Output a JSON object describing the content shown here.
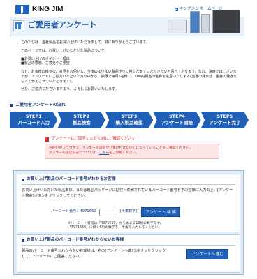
{
  "header": {
    "brand": "KING JIM",
    "home_link": "キングジム ホームページ"
  },
  "banner": {
    "title": "ご愛用者アンケート"
  },
  "intro": {
    "p1": "このたびは、当社製品をお買い上げいただきまして、誠にありがとうございます。",
    "p2": "このページでは、お買い上げいただいた製品について、",
    "p3a": "■お買い上げのポイント・理由",
    "p3b": "■製品の感想、ご意見やご要望",
    "p4": "など、お客様の様々なご意見をお伺いし、今後のよりよい製品作りに役立たせていただきたいと思っております。なお、常時ではございますが、アンケートにご協力いただいた方の中から、抽選で毎月5名様に、500円相当の金券を進呈いたします(当選の発表は、金券の発送をもってかえさせていただきます)。",
    "p5": "ぜひ、ご協力くださいますよう、よろしくお願いいたします。"
  },
  "flow": {
    "heading": "ご愛用者アンケートの流れ",
    "steps": [
      {
        "num": "STEP1",
        "label": "バーコード入力"
      },
      {
        "num": "STEP2",
        "label": "製品検索"
      },
      {
        "num": "STEP3",
        "label": "購入製品確認"
      },
      {
        "num": "STEP4",
        "label": "アンケート開始"
      },
      {
        "num": "STEP5",
        "label": "アンケート完了"
      }
    ]
  },
  "notice": {
    "heading": "アンケートにご回答いただく前にご確認ください",
    "line1": "お使いのブラウザで、クッキーの設定が「受け付けない」になっていることをご確認ください。",
    "line2_prefix": "クッキーの設定方法については、",
    "line2_link": "こちら",
    "line2_suffix": "をご参照ください。"
  },
  "barcode_section": {
    "title": "お買い上げ製品のバーコード番号がわかるお客様",
    "text": "お買い上げいただいた製品本体、または製品パッケージに貼付・印刷されているバーコード番号を下の空欄に入力の上、[アンケート検索]ボタンをクリックしてください。",
    "label": "バーコード番号：4971660",
    "hint": "[半角数字]",
    "button": "アンケート 検 索",
    "note1": "※バーコード番号は「4971660」から始まる13桁の数字です。",
    "note2": "「4971660」に続く6桁の数字を、半角で入力してください。"
  },
  "nobarcode_section": {
    "title": "お買い上げ製品のバーコード番号がわからないお客様",
    "text": "製品のバーコード番号がわからないお客様は、右の[アンケートへ進む]ボタンをクリックして、アンケートにご回答ください。",
    "button": "アンケートへ進む"
  },
  "colors": {
    "brand_blue": "#1f5fb5",
    "notice_red": "#d12b2b",
    "panel_bg": "#e3edf6"
  }
}
